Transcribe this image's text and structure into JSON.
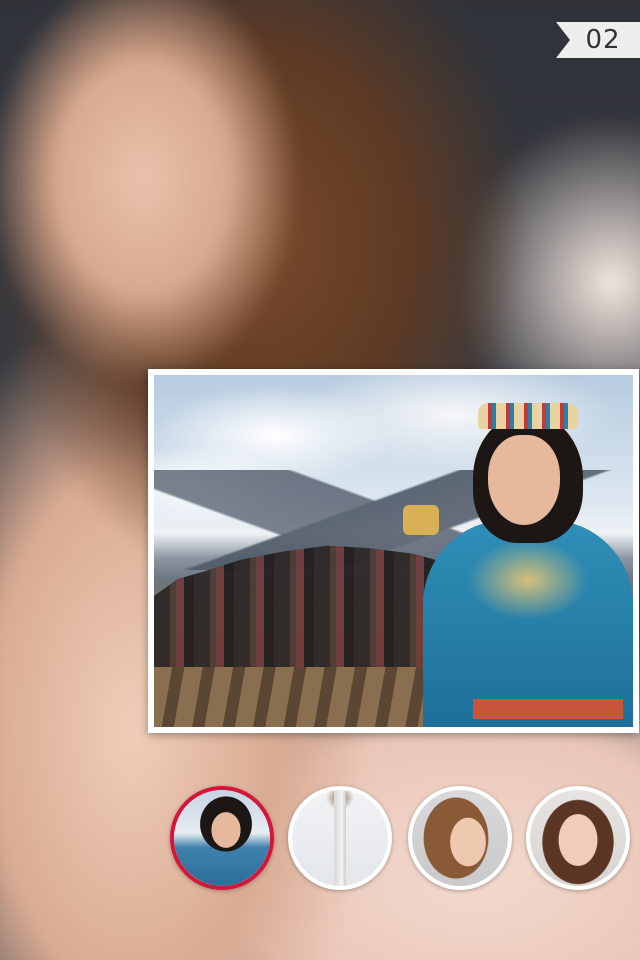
{
  "page_indicator": {
    "label": "02"
  },
  "background": {
    "description_icon": "portrait-background-image"
  },
  "main_photo": {
    "icon": "photo-image"
  },
  "thumbnails": [
    {
      "icon": "thumbnail-image",
      "selected": true
    },
    {
      "icon": "thumbnail-image",
      "selected": false
    },
    {
      "icon": "thumbnail-image",
      "selected": false
    },
    {
      "icon": "thumbnail-image",
      "selected": false
    }
  ],
  "colors": {
    "accent": "#d3163a",
    "badge_background": "#eeeeee",
    "badge_text": "#333333",
    "thumbnail_border": "#ffffff"
  }
}
